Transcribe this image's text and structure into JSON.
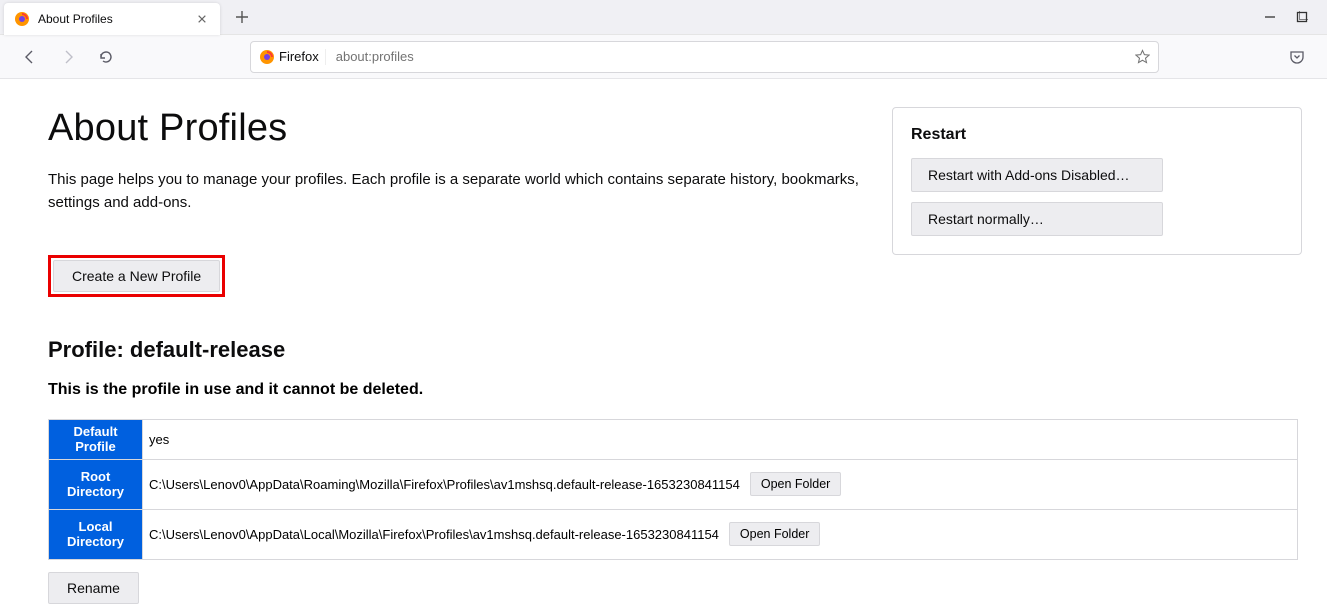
{
  "tab": {
    "title": "About Profiles"
  },
  "urlbar": {
    "brand": "Firefox",
    "address": "about:profiles"
  },
  "page": {
    "title": "About Profiles",
    "intro": "This page helps you to manage your profiles. Each profile is a separate world which contains separate history, bookmarks, settings and add-ons.",
    "create_label": "Create a New Profile"
  },
  "restart": {
    "heading": "Restart",
    "disabled_label": "Restart with Add-ons Disabled…",
    "normal_label": "Restart normally…"
  },
  "profile": {
    "heading": "Profile: default-release",
    "inuse_msg": "This is the profile in use and it cannot be deleted.",
    "rows": {
      "default": {
        "label": "Default Profile",
        "value": "yes"
      },
      "root": {
        "label": "Root Directory",
        "value": "C:\\Users\\Lenov0\\AppData\\Roaming\\Mozilla\\Firefox\\Profiles\\av1mshsq.default-release-1653230841154",
        "open": "Open Folder"
      },
      "local": {
        "label": "Local Directory",
        "value": "C:\\Users\\Lenov0\\AppData\\Local\\Mozilla\\Firefox\\Profiles\\av1mshsq.default-release-1653230841154",
        "open": "Open Folder"
      }
    },
    "rename_label": "Rename"
  }
}
